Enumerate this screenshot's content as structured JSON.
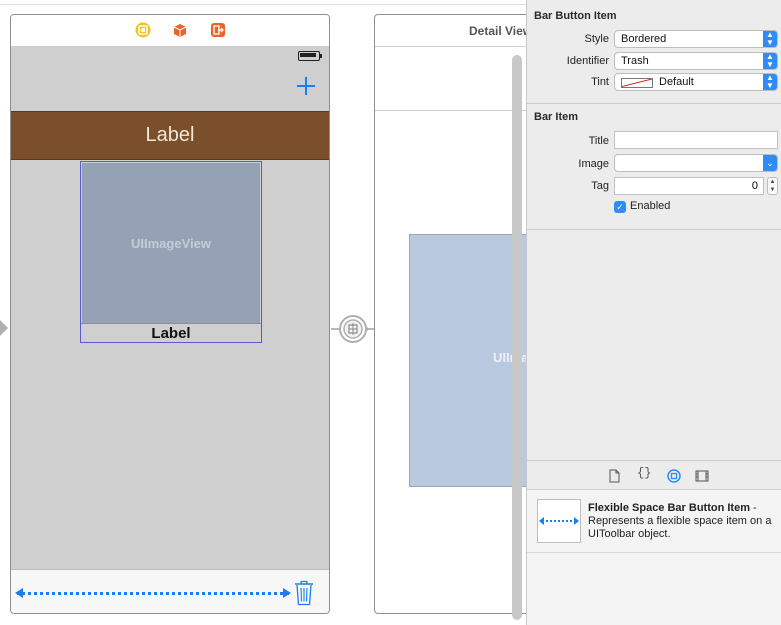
{
  "canvas": {
    "scene1": {
      "label_top": "Label",
      "imageview_label": "UIImageView",
      "cell_label": "Label"
    },
    "scene2": {
      "title": "Detail View",
      "imageview_label": "UIImageView"
    }
  },
  "inspector": {
    "bar_button_item": {
      "title": "Bar Button Item",
      "style_label": "Style",
      "style_value": "Bordered",
      "identifier_label": "Identifier",
      "identifier_value": "Trash",
      "tint_label": "Tint",
      "tint_value": "Default"
    },
    "bar_item": {
      "title": "Bar Item",
      "title_label": "Title",
      "title_value": "",
      "image_label": "Image",
      "image_value": "",
      "tag_label": "Tag",
      "tag_value": "0",
      "enabled_label": "Enabled",
      "enabled": true
    },
    "library": {
      "item_title": "Flexible Space Bar Button Item",
      "item_description": "- Represents a flexible space item on a UIToolbar object."
    }
  },
  "colors": {
    "accent": "#1a7ef2",
    "label_bg": "#7b4f2a",
    "imageview_bg": "#95a2b6"
  }
}
